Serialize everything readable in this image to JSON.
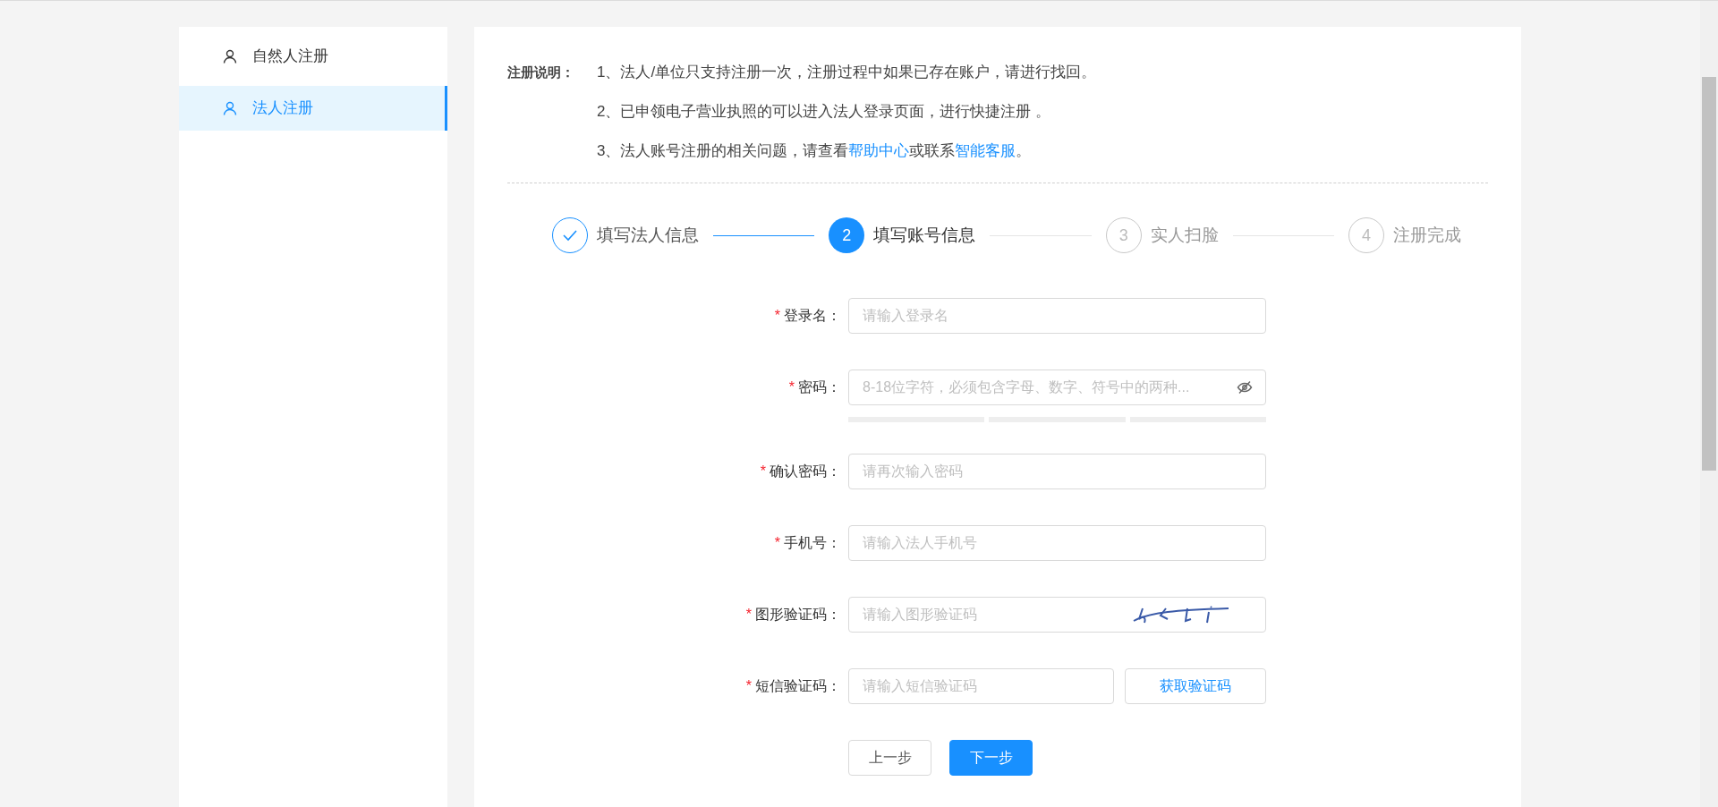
{
  "sidebar": {
    "items": [
      {
        "label": "自然人注册",
        "selected": false
      },
      {
        "label": "法人注册",
        "selected": true
      }
    ]
  },
  "notes": {
    "title": "注册说明：",
    "lines": [
      "1、法人/单位只支持注册一次，注册过程中如果已存在账户，请进行找回。",
      "2、已申领电子营业执照的可以进入法人登录页面，进行快捷注册 。"
    ],
    "last_line": {
      "prefix": "3、法人账号注册的相关问题，请查看",
      "link_1": "帮助中心",
      "middle": "或联系",
      "link_2": "智能客服",
      "suffix": "。"
    }
  },
  "steps": [
    {
      "label": "填写法人信息",
      "completed": true,
      "selected": false
    },
    {
      "number": "2",
      "label": "填写账号信息",
      "completed": false,
      "selected": true
    },
    {
      "number": "3",
      "label": "实人扫脸",
      "completed": false,
      "selected": false
    },
    {
      "number": "4",
      "label": "注册完成",
      "completed": false,
      "selected": false
    }
  ],
  "form": {
    "fields": [
      {
        "kind": "text",
        "required": "*",
        "label": "登录名：",
        "placeholder": "请输入登录名"
      },
      {
        "kind": "password",
        "required": "*",
        "label": "密码：",
        "placeholder": "8-18位字符，必须包含字母、数字、符号中的两种..."
      },
      {
        "kind": "text",
        "required": "*",
        "label": "确认密码：",
        "placeholder": "请再次输入密码"
      },
      {
        "kind": "text",
        "required": "*",
        "label": "手机号：",
        "placeholder": "请输入法人手机号"
      },
      {
        "kind": "captcha",
        "required": "*",
        "label": "图形验证码：",
        "placeholder": "请输入图形验证码"
      },
      {
        "kind": "sms",
        "required": "*",
        "label": "短信验证码：",
        "placeholder": "请输入短信验证码",
        "button": "获取验证码"
      }
    ],
    "buttons": [
      {
        "label": "上一步",
        "kind": "secondary"
      },
      {
        "label": "下一步",
        "kind": "primary"
      }
    ]
  }
}
